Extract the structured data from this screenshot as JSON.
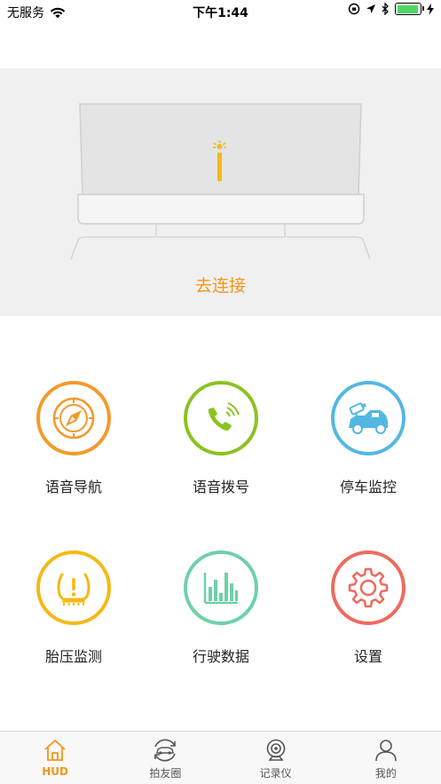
{
  "status_bar": {
    "carrier": "无服务",
    "time": "下午1:44",
    "battery_level": 0.95
  },
  "hero": {
    "connect_label": "去连接"
  },
  "colors": {
    "accent": "#f39617",
    "navigation": "#f39a2c",
    "dial": "#8cc21f",
    "parking": "#53b7e3",
    "tire": "#f5b914",
    "driving_data": "#6ed0a8",
    "settings": "#ef6a5e"
  },
  "features": [
    {
      "label": "语音导航",
      "icon": "compass-icon"
    },
    {
      "label": "语音拨号",
      "icon": "phone-icon"
    },
    {
      "label": "停车监控",
      "icon": "parking-camera-icon"
    },
    {
      "label": "胎压监测",
      "icon": "tire-pressure-icon"
    },
    {
      "label": "行驶数据",
      "icon": "bar-chart-icon"
    },
    {
      "label": "设置",
      "icon": "gear-icon"
    }
  ],
  "tabs": [
    {
      "label": "HUD",
      "icon": "home-icon",
      "active": true
    },
    {
      "label": "拍友圈",
      "icon": "car-refresh-icon",
      "active": false
    },
    {
      "label": "记录仪",
      "icon": "camera-icon",
      "active": false
    },
    {
      "label": "我的",
      "icon": "user-icon",
      "active": false
    }
  ]
}
